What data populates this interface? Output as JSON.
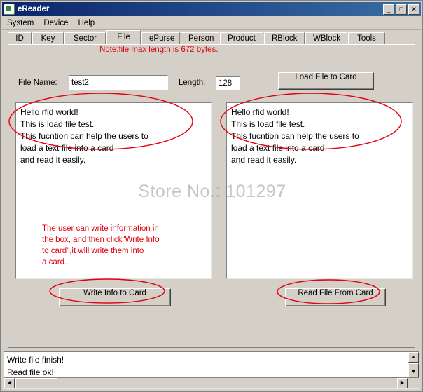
{
  "window": {
    "title": "eReader",
    "minimize_label": "_",
    "maximize_label": "□",
    "close_label": "✕"
  },
  "menubar": {
    "items": [
      {
        "label": "System"
      },
      {
        "label": "Device"
      },
      {
        "label": "Help"
      }
    ]
  },
  "tabs": [
    {
      "label": "ID",
      "active": false
    },
    {
      "label": "Key",
      "active": false
    },
    {
      "label": "Sector",
      "active": false
    },
    {
      "label": "File",
      "active": true
    },
    {
      "label": "ePurse",
      "active": false
    },
    {
      "label": "Person",
      "active": false
    },
    {
      "label": "Product",
      "active": false
    },
    {
      "label": "RBlock",
      "active": false
    },
    {
      "label": "WBlock",
      "active": false
    },
    {
      "label": "Tools",
      "active": false
    }
  ],
  "file_tab": {
    "note": "Note:file max length is 672 bytes.",
    "filename_label": "File Name:",
    "filename_value": "test2",
    "length_label": "Length:",
    "length_value": "128",
    "load_file_button": "Load File to Card",
    "left_textarea": "Hello rfid world!\nThis is load file test.\nThis fucntion can help the users to\nload a text file into a card\nand read it easily.",
    "right_textarea": "Hello rfid world!\nThis is load file test.\nThis fucntion can help the users to\nload a text file into a card\nand read it easily.",
    "annotation_text": "The user can write information in\nthe box, and then click\"Write Info\nto card\",it will write them into\na card.",
    "write_info_button": "Write Info to Card",
    "read_file_button": "Read File From Card"
  },
  "log": {
    "text": "Write file finish!\nRead file ok!"
  },
  "scrollbars": {
    "up_arrow": "▲",
    "down_arrow": "▼",
    "left_arrow": "◀",
    "right_arrow": "▶"
  },
  "watermark": "Store No.: 101297",
  "colors": {
    "accent_red": "#e3000f",
    "title_blue": "#0a246a",
    "face": "#d4d0c8"
  }
}
